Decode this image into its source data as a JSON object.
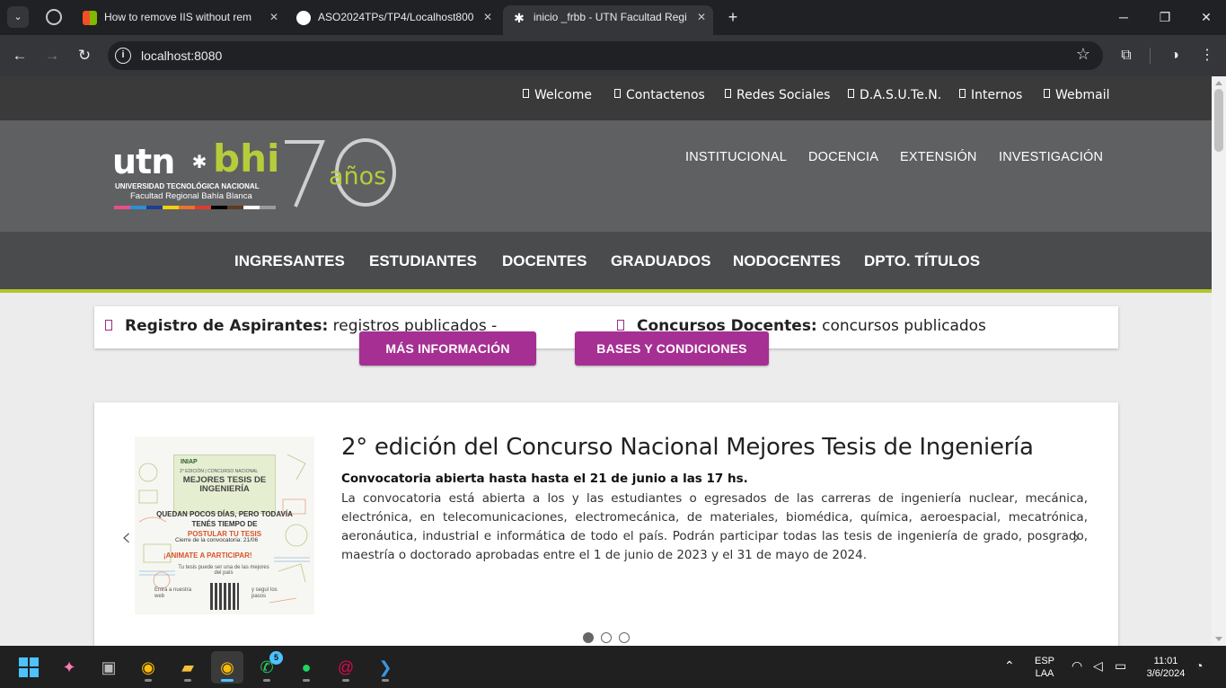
{
  "browser": {
    "tabs": [
      {
        "title": "How to remove IIS without rem",
        "favicon_color": "#f25022",
        "active": false
      },
      {
        "title": "ASO2024TPs/TP4/Localhost800",
        "favicon_color": "#ffffff",
        "active": false
      },
      {
        "title": "inicio _frbb - UTN Facultad Regi",
        "favicon_color": "#ffffff",
        "active": true
      }
    ],
    "new_tab": "+",
    "url": "localhost:8080"
  },
  "site": {
    "toplinks": [
      "Welcome",
      "Contactenos",
      "Redes Sociales",
      "D.A.S.U.Te.N.",
      "Internos",
      "Webmail"
    ],
    "logo": {
      "utn": "utn",
      "bhi": "bhi",
      "line1": "UNIVERSIDAD TECNOLÓGICA NACIONAL",
      "line2": "Facultad Regional Bahía Blanca",
      "seventy": "70",
      "anos": "años",
      "stripe_colors": [
        "#e94e8a",
        "#2d8fd5",
        "#1d3f8f",
        "#f4d20c",
        "#e9742c",
        "#e23a2e",
        "#000000",
        "#5c3b22",
        "#ffffff",
        "#9b9b9b"
      ]
    },
    "header_nav": [
      "INSTITUCIONAL",
      "DOCENCIA",
      "EXTENSIÓN",
      "INVESTIGACIÓN"
    ],
    "main_nav": [
      "INGRESANTES",
      "ESTUDIANTES",
      "DOCENTES",
      "GRADUADOS",
      "NODOCENTES",
      "DPTO. TÍTULOS"
    ],
    "ticker": [
      {
        "label": "Registro de Aspirantes:",
        "text": "registros publicados -"
      },
      {
        "label": "Concursos Docentes:",
        "text": "concursos publicados"
      }
    ],
    "slide": {
      "title": "2° edición del Concurso Nacional Mejores Tesis de Ingeniería",
      "subtitle": "Convocatoria abierta hasta hasta el 21 de junio a las 17 hs.",
      "body": "La convocatoria está abierta a los y las estudiantes o egresados de las carreras de ingeniería nuclear, mecánica, electrónica, en telecomunicaciones, electromecánica, de materiales, biomédica, química, aeroespacial, mecatrónica, aeronáutica, industrial e informática de todo el país. Podrán participar todas las tesis de ingeniería de grado, posgrado, maestría o doctorado aprobadas entre el 1 de junio de 2023 y el 31 de mayo de 2024.",
      "button_more": "MÁS INFORMACIÓN",
      "button_bases": "BASES Y CONDICIONES",
      "poster": {
        "org": "INIAP",
        "edition": "2° EDICIÓN | CONCURSO NACIONAL",
        "title": "MEJORES TESIS DE INGENIERÍA",
        "q1": "QUEDAN POCOS DÍAS, PERO TODAVÍA TENÉS TIEMPO DE",
        "q2": "POSTULAR TU TESIS",
        "cierre": "Cierre de la convocatoria: 21/06",
        "animate": "¡ANIMATE A PARTICIPAR!",
        "tesis": "Tu tesis puede ser una de las mejores del país",
        "entra": "Entra a nuestra web",
        "segui": "y seguí los pasos"
      },
      "dots": 3,
      "active_dot": 0
    },
    "accent_color": "#a62f93",
    "brand_green": "#b7cc3a"
  },
  "taskbar": {
    "lang1": "ESP",
    "lang2": "LAA",
    "time": "11:01",
    "date": "3/6/2024",
    "whatsapp_badge": "5"
  }
}
